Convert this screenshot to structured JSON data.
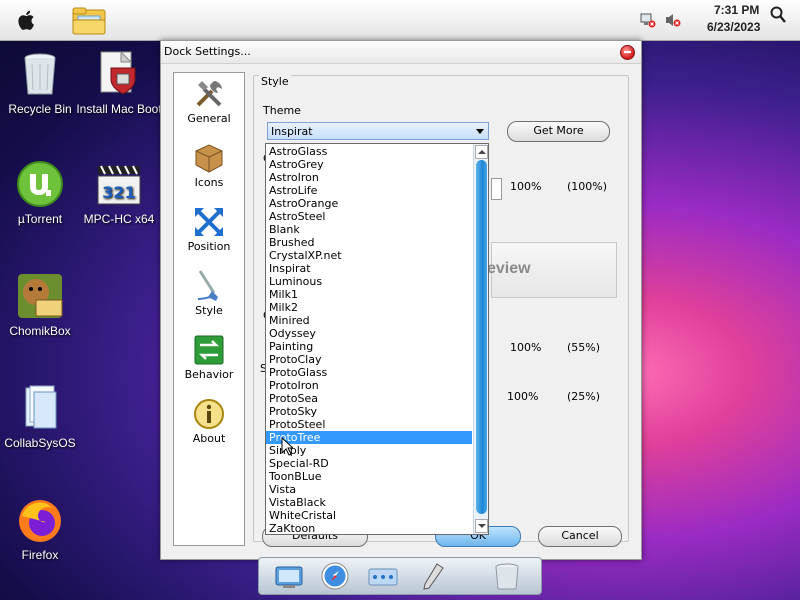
{
  "menubar": {
    "time": "7:31 PM",
    "date": "6/23/2023",
    "icons": [
      "apple-icon",
      "folder-icon",
      "network-tray-icon",
      "volume-muted-tray-icon",
      "search-icon"
    ]
  },
  "desktop": {
    "icons": [
      {
        "label": "Recycle Bin",
        "icon": "recycle-bin-icon"
      },
      {
        "label": "Install Mac Boot",
        "icon": "install-mac-boot-icon"
      },
      {
        "label": "µTorrent",
        "icon": "utorrent-icon"
      },
      {
        "label": "MPC-HC x64",
        "icon": "mpc-hc-icon"
      },
      {
        "label": "ChomikBox",
        "icon": "chomikbox-icon"
      },
      {
        "label": "CollabSysOS",
        "icon": "collabsysos-icon"
      },
      {
        "label": "Firefox",
        "icon": "firefox-icon"
      }
    ]
  },
  "dialog": {
    "title": "Dock Settings...",
    "nav": [
      {
        "label": "General",
        "icon": "tools-icon"
      },
      {
        "label": "Icons",
        "icon": "box-icon"
      },
      {
        "label": "Position",
        "icon": "arrows-icon"
      },
      {
        "label": "Style",
        "icon": "brush-icon"
      },
      {
        "label": "Behavior",
        "icon": "behavior-icon"
      },
      {
        "label": "About",
        "icon": "info-icon"
      }
    ],
    "style_group": {
      "legend": "Style",
      "theme_label": "Theme",
      "theme_value": "Inspirat",
      "get_more_label": "Get More",
      "row1": {
        "percent": "100%",
        "paren": "(100%)"
      },
      "preview_text": "eview",
      "row2": {
        "percent": "100%",
        "paren": "(55%)"
      },
      "row3": {
        "percent": "100%",
        "paren": "(25%)"
      },
      "partial_labels": [
        "C",
        "C",
        "S"
      ]
    },
    "buttons": {
      "defaults": "Defaults",
      "ok": "OK",
      "cancel": "Cancel"
    },
    "theme_list": {
      "selected": "ProtoTree",
      "items": [
        "AstroGlass",
        "AstroGrey",
        "AstroIron",
        "AstroLife",
        "AstroOrange",
        "AstroSteel",
        "Blank",
        "Brushed",
        "CrystalXP.net",
        "Inspirat",
        "Luminous",
        "Milk1",
        "Milk2",
        "Minired",
        "Odyssey",
        "Painting",
        "ProtoClay",
        "ProtoGlass",
        "ProtoIron",
        "ProtoSea",
        "ProtoSky",
        "ProtoSteel",
        "ProtoTree",
        "Simply",
        "Special-RD",
        "ToonBLue",
        "Vista",
        "VistaBlack",
        "WhiteCristal",
        "ZaKtoon"
      ]
    }
  },
  "dock": {
    "icons": [
      "finder-icon",
      "safari-icon",
      "screen-icon",
      "pen-icon",
      "trash-icon"
    ]
  }
}
